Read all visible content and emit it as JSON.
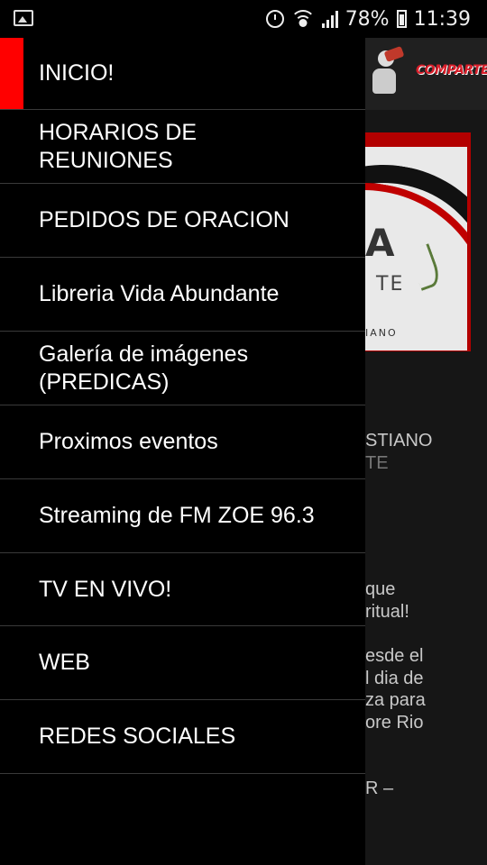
{
  "status_bar": {
    "battery": "78%",
    "time": "11:39",
    "icons": [
      "gallery-icon",
      "alarm-icon",
      "wifi-icon",
      "signal-icon",
      "battery-icon"
    ]
  },
  "drawer": {
    "active_color": "#ff0000",
    "items": [
      {
        "label": "INICIO!",
        "active": true
      },
      {
        "label": "HORARIOS DE REUNIONES"
      },
      {
        "label": "PEDIDOS DE ORACION"
      },
      {
        "label": "Libreria Vida Abundante"
      },
      {
        "label": "Galería de imágenes (PREDICAS)"
      },
      {
        "label": "Proximos eventos"
      },
      {
        "label": "Streaming de FM ZOE 96.3"
      },
      {
        "label": "TV EN VIVO!"
      },
      {
        "label": "WEB"
      },
      {
        "label": "REDES SOCIALES"
      }
    ]
  },
  "background": {
    "share_label": "COMPARTE",
    "banner": {
      "letter": "A",
      "text": "TE",
      "subtitle": "IANO"
    },
    "lines": [
      "STIANO",
      "TE",
      "que",
      "ritual!",
      "esde el",
      "l dia de",
      "za para",
      "ore Rio",
      "R –"
    ]
  }
}
